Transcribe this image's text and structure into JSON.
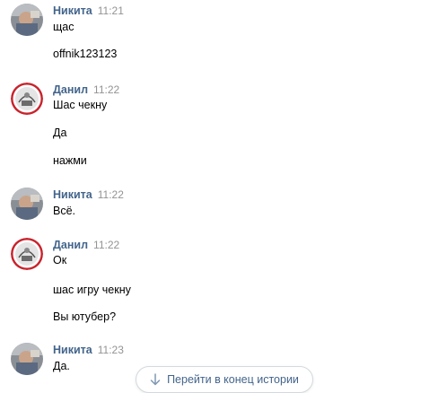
{
  "messages": [
    {
      "author": "Никита",
      "time": "11:21",
      "avatar_icon": "user-photo-nikita",
      "lines": [
        "щас",
        "offnik123123"
      ]
    },
    {
      "author": "Данил",
      "time": "11:22",
      "avatar_icon": "user-photo-danil",
      "lines": [
        "Шас чекну",
        "Да",
        "нажми"
      ]
    },
    {
      "author": "Никита",
      "time": "11:22",
      "avatar_icon": "user-photo-nikita",
      "lines": [
        "Всё."
      ]
    },
    {
      "author": "Данил",
      "time": "11:22",
      "avatar_icon": "user-photo-danil",
      "lines": [
        "Ок",
        "шас игру чекну",
        "Вы ютубер?"
      ]
    },
    {
      "author": "Никита",
      "time": "11:23",
      "avatar_icon": "user-photo-nikita",
      "lines": [
        "Да."
      ]
    }
  ],
  "jump_to_end": {
    "label": "Перейти в конец истории",
    "icon": "arrow-down-icon"
  },
  "colors": {
    "author_name": "#42648b",
    "time": "#939393",
    "button_border": "#d3d9de",
    "link_text": "#42648b"
  }
}
